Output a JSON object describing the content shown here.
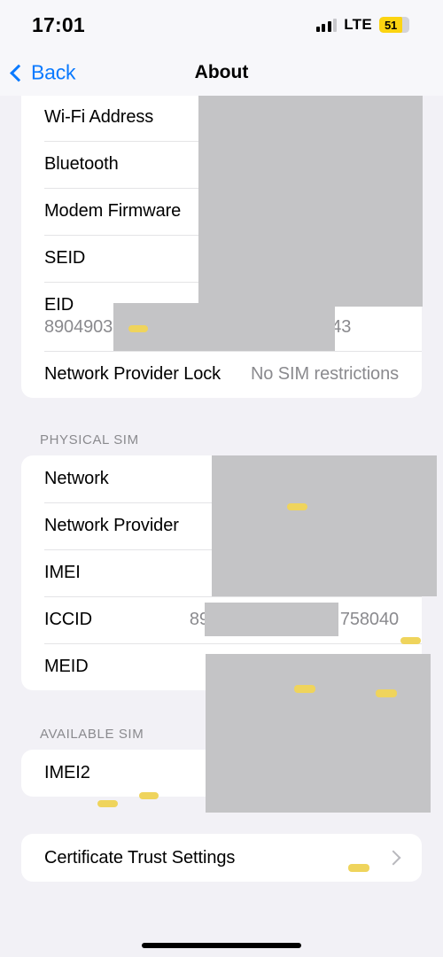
{
  "status_bar": {
    "time": "17:01",
    "network_type": "LTE",
    "battery_level": "51",
    "battery_low_power_color": "#fcd411",
    "signal_icon": "cellular-signal-icon"
  },
  "nav": {
    "back_label": "Back",
    "title": "About",
    "accent_color": "#0a7aff"
  },
  "sections": [
    {
      "header": "",
      "rows": [
        {
          "label": "Wi-Fi Address",
          "value": ""
        },
        {
          "label": "Bluetooth",
          "value": ""
        },
        {
          "label": "Modem Firmware",
          "value": ""
        },
        {
          "label": "SEID",
          "value": ""
        },
        {
          "label": "EID",
          "value": "8904903",
          "value_tail": "543"
        },
        {
          "label": "Network Provider Lock",
          "value": "No SIM restrictions"
        }
      ]
    },
    {
      "header": "PHYSICAL SIM",
      "rows": [
        {
          "label": "Network",
          "value": ""
        },
        {
          "label": "Network Provider",
          "value": ""
        },
        {
          "label": "IMEI",
          "value": ""
        },
        {
          "label": "ICCID",
          "value": "89",
          "value_tail": "758040"
        },
        {
          "label": "MEID",
          "value": ""
        }
      ]
    },
    {
      "header": "AVAILABLE SIM",
      "rows": [
        {
          "label": "IMEI2",
          "value": ""
        }
      ]
    },
    {
      "header": "",
      "rows": [
        {
          "label": "Certificate Trust Settings",
          "value": "",
          "chevron": true
        }
      ]
    }
  ],
  "redaction": {
    "color": "#c4c4c6",
    "highlight_color": "#efd45c"
  }
}
